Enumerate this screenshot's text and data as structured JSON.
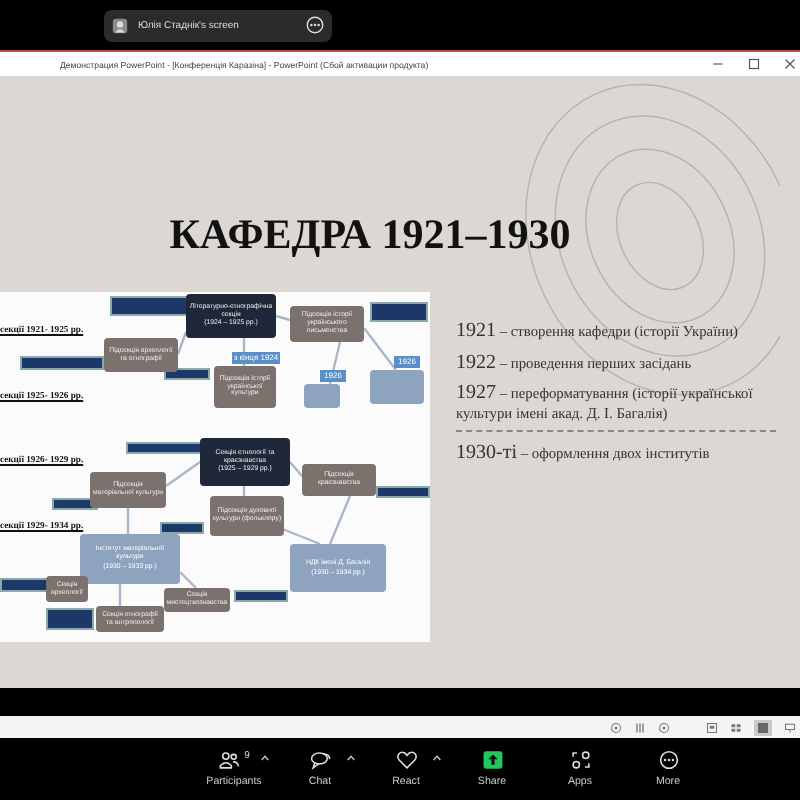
{
  "screen_share_badge": {
    "label": "Юлія Стаднік's screen"
  },
  "window": {
    "title": "Демонстрация PowerPoint - [Конференція Каразіна] - PowerPoint (Сбой активации продукта)"
  },
  "slide": {
    "title": "КАФЕДРА 1921–1930",
    "diagram": {
      "section_labels": [
        "секції 1921- 1925 рр.",
        "секції 1925- 1926 рр.",
        "секції 1926- 1929 рр.",
        "секції 1929- 1934 рр."
      ],
      "nodes": [
        {
          "kind": "section",
          "text": "Літературно-етнографічна секція",
          "period": "(1924 – 1925 рр.)"
        },
        {
          "kind": "subsection",
          "text": "Підсекція археології та етнографії"
        },
        {
          "kind": "subsection",
          "text": "Підсекція історії української культури"
        },
        {
          "kind": "subsection",
          "text": "Підсекція історії українського письменства"
        },
        {
          "kind": "institute"
        },
        {
          "kind": "institute"
        },
        {
          "kind": "year",
          "text": "з кінця 1924"
        },
        {
          "kind": "year",
          "text": "1926"
        },
        {
          "kind": "year",
          "text": "1926"
        },
        {
          "kind": "section",
          "text": "Секція етнології та краєзнавства",
          "period": "(1925 – 1929 рр.)"
        },
        {
          "kind": "subsection",
          "text": "Підсекція матеріальної культури"
        },
        {
          "kind": "subsection",
          "text": "Підсекція краєзнавства"
        },
        {
          "kind": "subsection",
          "text": "Підсекція духовної культури (фольклору)"
        },
        {
          "kind": "institute",
          "text": "Інститут матеріальної культури",
          "period": "(1930 – 1933 рр.)"
        },
        {
          "kind": "institute",
          "text": "НДК імені Д. Багалія",
          "period": "(1930 – 1934 рр.)"
        },
        {
          "kind": "subsection",
          "text": "Секція археології"
        },
        {
          "kind": "subsection",
          "text": "Секція мистецтвознавства"
        },
        {
          "kind": "subsection",
          "text": "Секція етнографії та антропології"
        }
      ]
    },
    "timeline": [
      {
        "year": "1921",
        "text": "– створення кафедри (історії України)",
        "divider_after": false
      },
      {
        "year": "1922",
        "text": "– проведення перших засідань",
        "divider_after": false
      },
      {
        "year": "1927",
        "text": "– переформатування (історії української культури імені акад. Д. І. Багалія)",
        "divider_after": true
      },
      {
        "year": "1930-ті",
        "text": "– оформлення двох інститутів",
        "divider_after": false
      }
    ]
  },
  "toolbar": [
    {
      "kind": "participants",
      "label": "Participants",
      "count": "9",
      "has_menu": true
    },
    {
      "kind": "chat",
      "label": "Chat",
      "has_menu": true
    },
    {
      "kind": "react",
      "label": "React",
      "has_menu": true
    },
    {
      "kind": "share",
      "label": "Share",
      "has_menu": false
    },
    {
      "kind": "apps",
      "label": "Apps",
      "has_menu": false
    },
    {
      "kind": "more",
      "label": "More",
      "has_menu": false
    }
  ]
}
